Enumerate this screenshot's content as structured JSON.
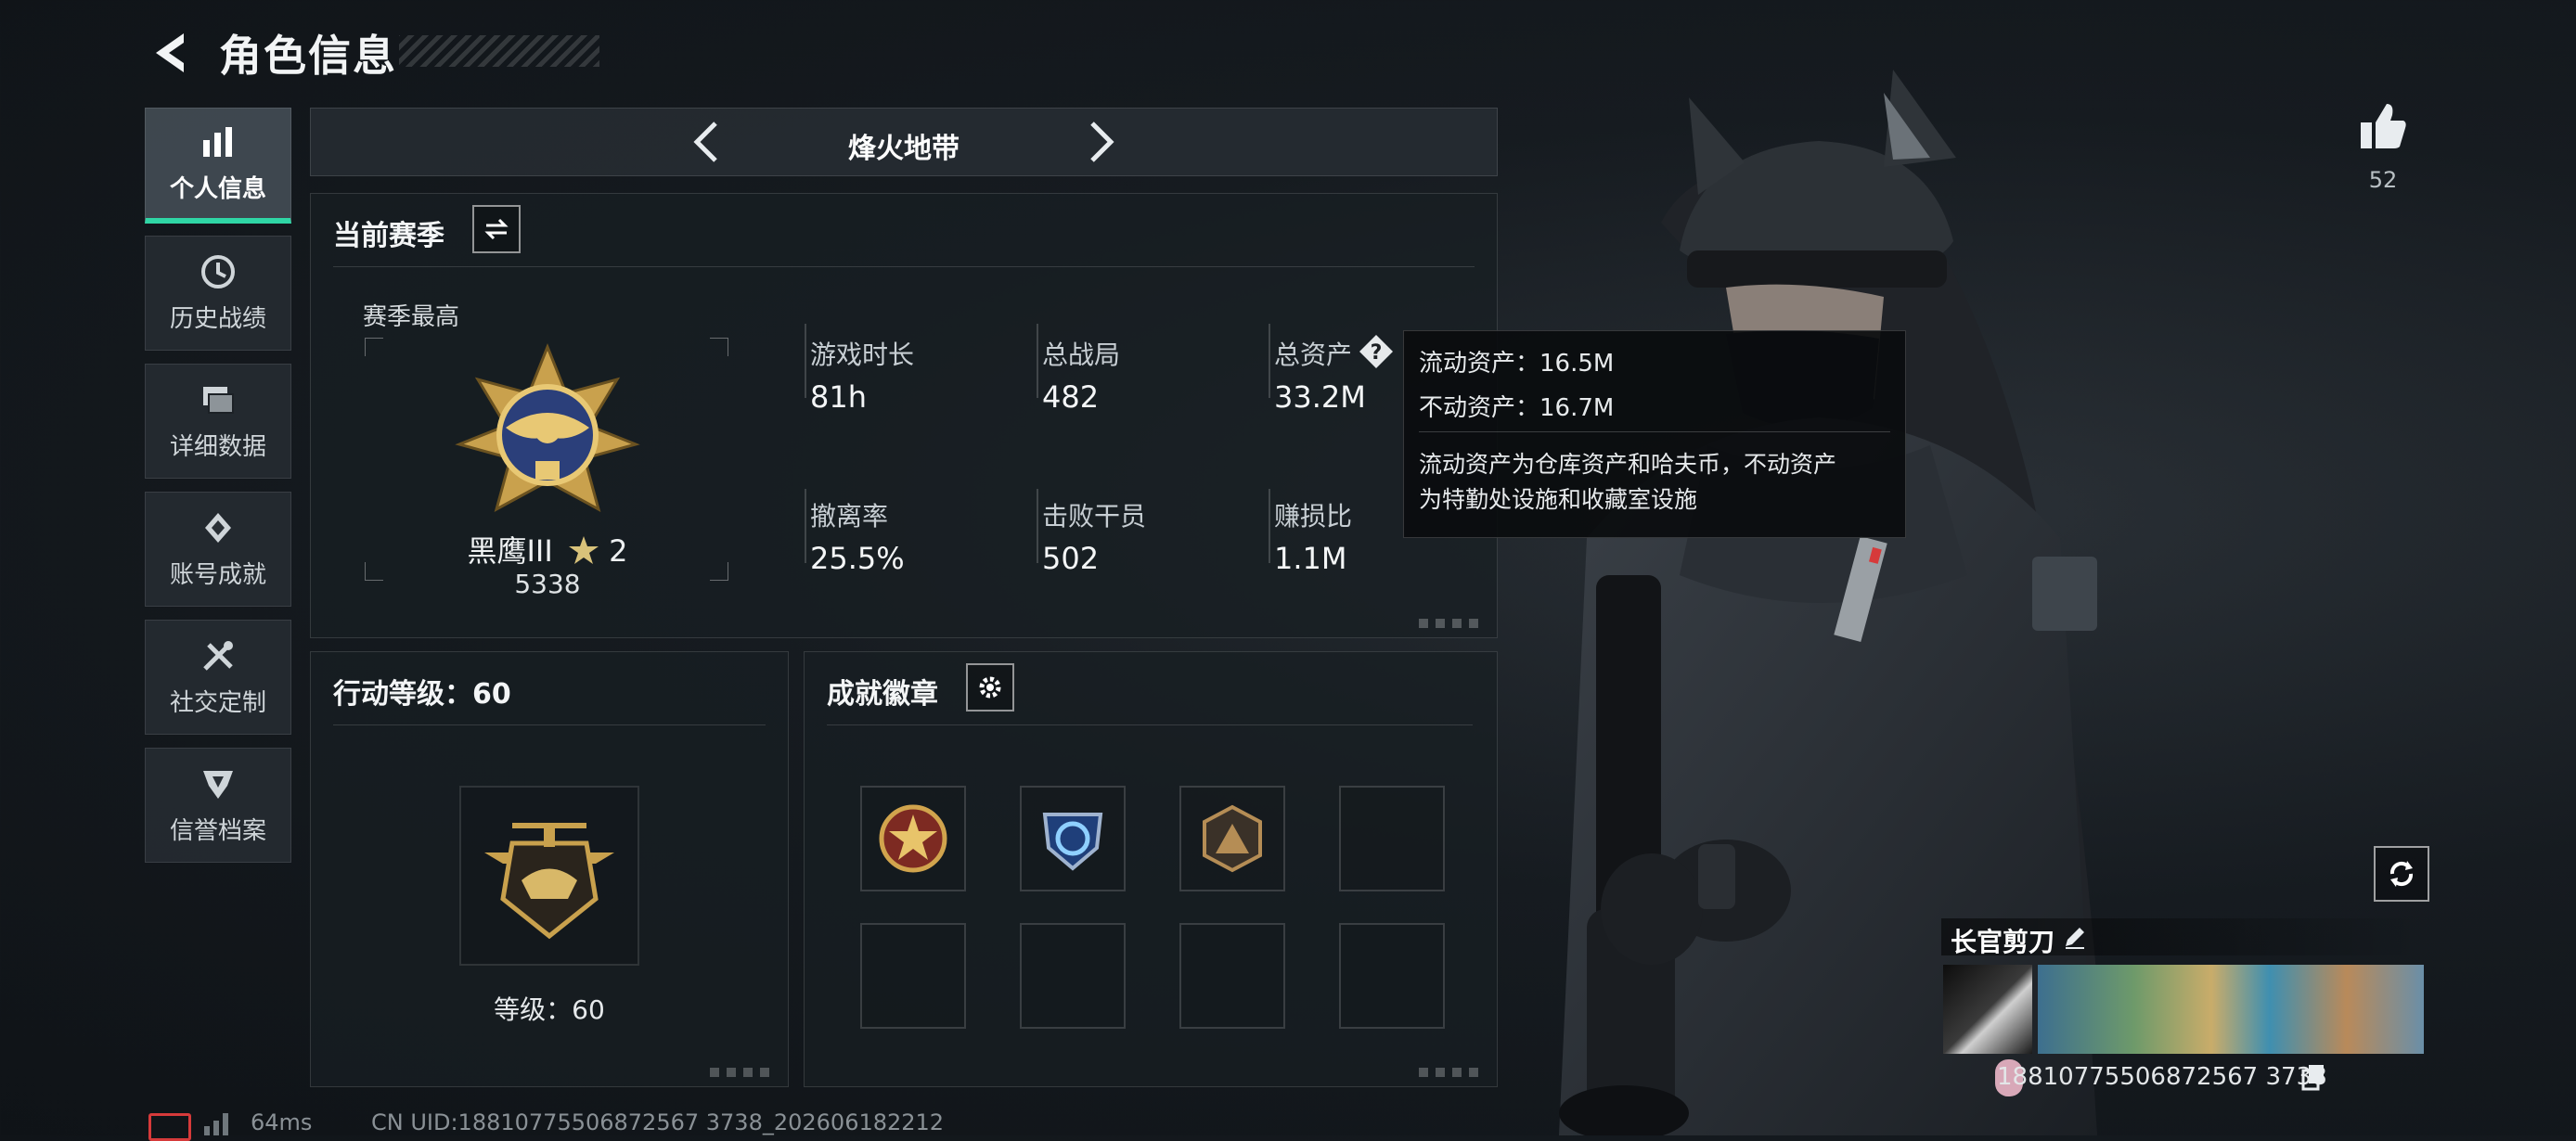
{
  "header": {
    "title": "角色信息"
  },
  "sidebar": {
    "items": [
      {
        "label": "个人信息",
        "icon": "bar-chart-icon"
      },
      {
        "label": "历史战绩",
        "icon": "clock-history-icon"
      },
      {
        "label": "详细数据",
        "icon": "cards-icon"
      },
      {
        "label": "账号成就",
        "icon": "achievement-icon"
      },
      {
        "label": "社交定制",
        "icon": "tools-icon"
      },
      {
        "label": "信誉档案",
        "icon": "credit-shield-icon"
      }
    ]
  },
  "mode": {
    "label": "烽火地带"
  },
  "season": {
    "title": "当前赛季",
    "best_label": "赛季最高",
    "rank_name": "黑鹰III",
    "rank_stars": "2",
    "rank_score": "5338",
    "stats": [
      {
        "label": "游戏时长",
        "value": "81h"
      },
      {
        "label": "总战局",
        "value": "482"
      },
      {
        "label": "总资产",
        "value": "33.2M"
      },
      {
        "label": "撤离率",
        "value": "25.5%"
      },
      {
        "label": "击败干员",
        "value": "502"
      },
      {
        "label": "赚损比",
        "value": "1.1M"
      }
    ]
  },
  "tooltip": {
    "line1": "流动资产：16.5M",
    "line2": "不动资产：16.7M",
    "line3": "流动资产为仓库资产和哈夫币，不动资产",
    "line4": "为特勤处设施和收藏室设施"
  },
  "action_level": {
    "title": "行动等级：60",
    "level_text": "等级：60"
  },
  "badges": {
    "title": "成就徽章"
  },
  "player": {
    "likes": "52",
    "name": "长官剪刀",
    "uid": "18810775506872567 3738"
  },
  "footer": {
    "ping": "64ms",
    "uid_line": "CN UID:18810775506872567 3738_202606182212"
  },
  "colors": {
    "accent": "#2fd6a5",
    "tooltip_bg": "#0a0c0e"
  }
}
